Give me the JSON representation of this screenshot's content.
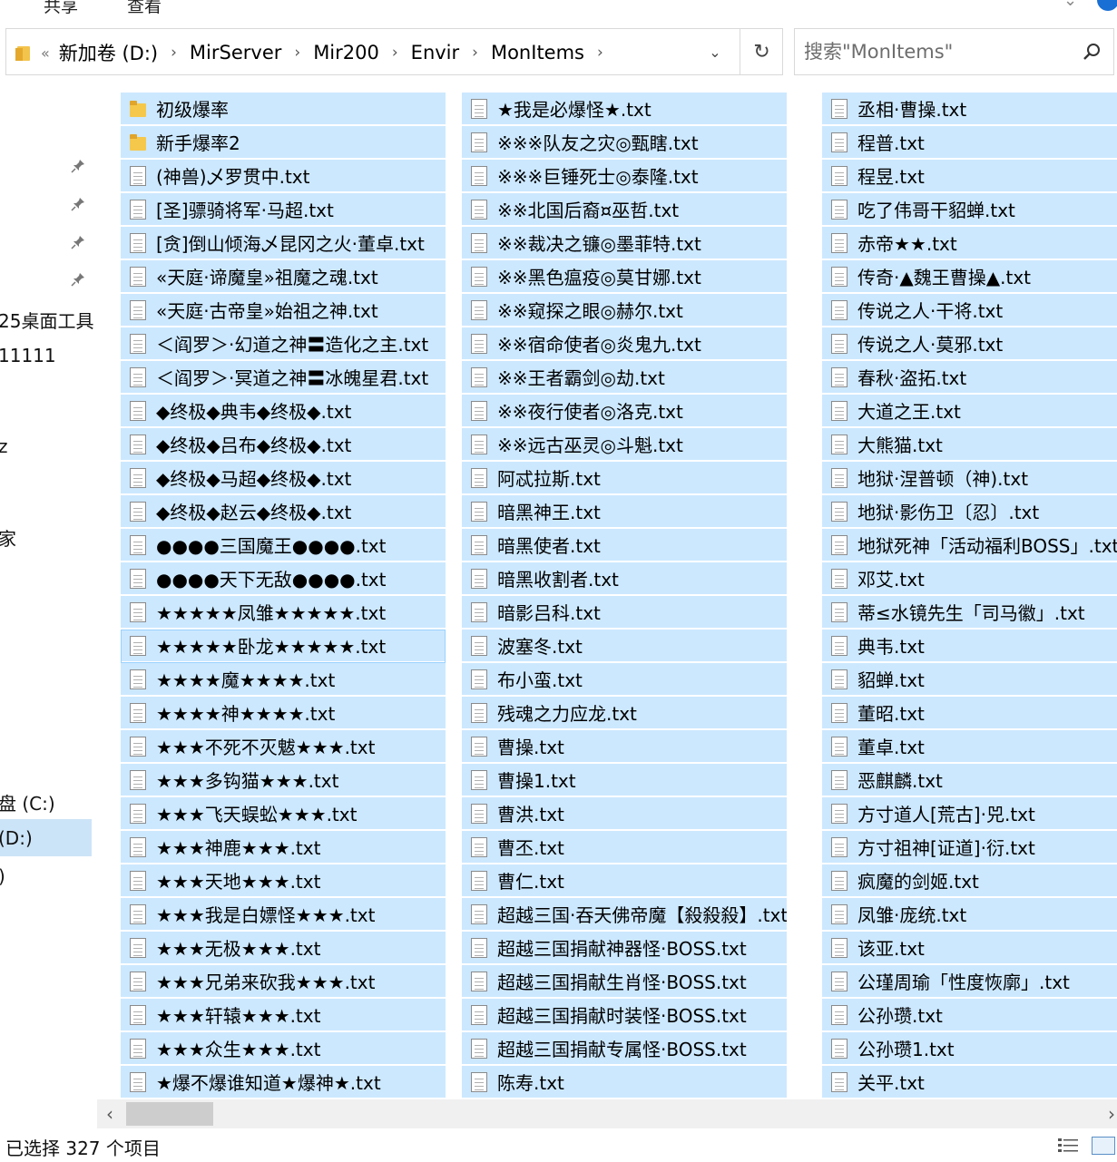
{
  "ribbon": {
    "tabs": [
      "共享",
      "查看"
    ]
  },
  "address": {
    "overflow": "«",
    "crumbs": [
      "新加卷 (D:)",
      "MirServer",
      "Mir200",
      "Envir",
      "MonItems"
    ]
  },
  "search": {
    "placeholder": "搜索\"MonItems\""
  },
  "nav": {
    "items": [
      "25桌面工具",
      "11111",
      "z",
      "家",
      "盘 (C:)",
      "(D:)",
      ")"
    ]
  },
  "files": {
    "col1": [
      {
        "name": "初级爆率",
        "type": "folder"
      },
      {
        "name": "新手爆率2",
        "type": "folder"
      },
      {
        "name": "(神兽)乄罗贯中.txt",
        "type": "file"
      },
      {
        "name": "[圣]骠骑将军·马超.txt",
        "type": "file"
      },
      {
        "name": "[贪]倒山倾海乄昆冈之火·董卓.txt",
        "type": "file"
      },
      {
        "name": "«天庭·谛魔皇»祖魔之魂.txt",
        "type": "file"
      },
      {
        "name": "«天庭·古帝皇»始祖之神.txt",
        "type": "file"
      },
      {
        "name": "＜阎罗＞·幻道之神〓造化之主.txt",
        "type": "file"
      },
      {
        "name": "＜阎罗＞·冥道之神〓冰魄星君.txt",
        "type": "file"
      },
      {
        "name": "◆终极◆典韦◆终极◆.txt",
        "type": "file"
      },
      {
        "name": "◆终极◆吕布◆终极◆.txt",
        "type": "file"
      },
      {
        "name": "◆终极◆马超◆终极◆.txt",
        "type": "file"
      },
      {
        "name": "◆终极◆赵云◆终极◆.txt",
        "type": "file"
      },
      {
        "name": "●●●●三国魔王●●●●.txt",
        "type": "file"
      },
      {
        "name": "●●●●天下无敌●●●●.txt",
        "type": "file"
      },
      {
        "name": "★★★★★凤雏★★★★★.txt",
        "type": "file"
      },
      {
        "name": "★★★★★卧龙★★★★★.txt",
        "type": "file"
      },
      {
        "name": "★★★★魔★★★★.txt",
        "type": "file"
      },
      {
        "name": "★★★★神★★★★.txt",
        "type": "file"
      },
      {
        "name": "★★★不死不灭魃★★★.txt",
        "type": "file"
      },
      {
        "name": "★★★多钩猫★★★.txt",
        "type": "file"
      },
      {
        "name": "★★★飞天蜈蚣★★★.txt",
        "type": "file"
      },
      {
        "name": "★★★神鹿★★★.txt",
        "type": "file"
      },
      {
        "name": "★★★天地★★★.txt",
        "type": "file"
      },
      {
        "name": "★★★我是白嫖怪★★★.txt",
        "type": "file"
      },
      {
        "name": "★★★无极★★★.txt",
        "type": "file"
      },
      {
        "name": "★★★兄弟来砍我★★★.txt",
        "type": "file"
      },
      {
        "name": "★★★轩辕★★★.txt",
        "type": "file"
      },
      {
        "name": "★★★众生★★★.txt",
        "type": "file"
      },
      {
        "name": "★爆不爆谁知道★爆神★.txt",
        "type": "file"
      }
    ],
    "col2": [
      {
        "name": "★我是必爆怪★.txt",
        "type": "file"
      },
      {
        "name": "※※※队友之灾◎甄瞎.txt",
        "type": "file"
      },
      {
        "name": "※※※巨锤死士◎泰隆.txt",
        "type": "file"
      },
      {
        "name": "※※北国后裔¤巫哲.txt",
        "type": "file"
      },
      {
        "name": "※※裁决之镰◎墨菲特.txt",
        "type": "file"
      },
      {
        "name": "※※黑色瘟疫◎莫甘娜.txt",
        "type": "file"
      },
      {
        "name": "※※窥探之眼◎赫尔.txt",
        "type": "file"
      },
      {
        "name": "※※宿命使者◎炎鬼九.txt",
        "type": "file"
      },
      {
        "name": "※※王者霸剑◎劫.txt",
        "type": "file"
      },
      {
        "name": "※※夜行使者◎洛克.txt",
        "type": "file"
      },
      {
        "name": "※※远古巫灵◎斗魁.txt",
        "type": "file"
      },
      {
        "name": "阿忒拉斯.txt",
        "type": "file"
      },
      {
        "name": "暗黑神王.txt",
        "type": "file"
      },
      {
        "name": "暗黑使者.txt",
        "type": "file"
      },
      {
        "name": "暗黑收割者.txt",
        "type": "file"
      },
      {
        "name": "暗影吕科.txt",
        "type": "file"
      },
      {
        "name": "波塞冬.txt",
        "type": "file"
      },
      {
        "name": "布小蛮.txt",
        "type": "file"
      },
      {
        "name": "残魂之力应龙.txt",
        "type": "file"
      },
      {
        "name": "曹操.txt",
        "type": "file"
      },
      {
        "name": "曹操1.txt",
        "type": "file"
      },
      {
        "name": "曹洪.txt",
        "type": "file"
      },
      {
        "name": "曹丕.txt",
        "type": "file"
      },
      {
        "name": "曹仁.txt",
        "type": "file"
      },
      {
        "name": "超越三国·吞天佛帝魔【殺殺殺】.txt",
        "type": "file"
      },
      {
        "name": "超越三国捐献神器怪·BOSS.txt",
        "type": "file"
      },
      {
        "name": "超越三国捐献生肖怪·BOSS.txt",
        "type": "file"
      },
      {
        "name": "超越三国捐献时装怪·BOSS.txt",
        "type": "file"
      },
      {
        "name": "超越三国捐献专属怪·BOSS.txt",
        "type": "file"
      },
      {
        "name": "陈寿.txt",
        "type": "file"
      }
    ],
    "col3": [
      {
        "name": "丞相·曹操.txt",
        "type": "file"
      },
      {
        "name": "程普.txt",
        "type": "file"
      },
      {
        "name": "程昱.txt",
        "type": "file"
      },
      {
        "name": "吃了伟哥干貂蝉.txt",
        "type": "file"
      },
      {
        "name": "赤帝★★.txt",
        "type": "file"
      },
      {
        "name": "传奇·▲魏王曹操▲.txt",
        "type": "file"
      },
      {
        "name": "传说之人·干将.txt",
        "type": "file"
      },
      {
        "name": "传说之人·莫邪.txt",
        "type": "file"
      },
      {
        "name": "春秋·盗拓.txt",
        "type": "file"
      },
      {
        "name": "大道之王.txt",
        "type": "file"
      },
      {
        "name": "大熊猫.txt",
        "type": "file"
      },
      {
        "name": "地狱·涅普顿（神).txt",
        "type": "file"
      },
      {
        "name": "地狱·影伤卫〔忍〕.txt",
        "type": "file"
      },
      {
        "name": "地狱死神「活动福利BOSS」.txt",
        "type": "file"
      },
      {
        "name": "邓艾.txt",
        "type": "file"
      },
      {
        "name": "蒂≤水镜先生「司马徽」.txt",
        "type": "file"
      },
      {
        "name": "典韦.txt",
        "type": "file"
      },
      {
        "name": "貂蝉.txt",
        "type": "file"
      },
      {
        "name": "董昭.txt",
        "type": "file"
      },
      {
        "name": "董卓.txt",
        "type": "file"
      },
      {
        "name": "恶麒麟.txt",
        "type": "file"
      },
      {
        "name": "方寸道人[荒古]·兕.txt",
        "type": "file"
      },
      {
        "name": "方寸祖神[证道]·衍.txt",
        "type": "file"
      },
      {
        "name": "疯魔的剑姬.txt",
        "type": "file"
      },
      {
        "name": "凤雏·庞统.txt",
        "type": "file"
      },
      {
        "name": "该亚.txt",
        "type": "file"
      },
      {
        "name": "公瑾周瑜「性度恢廓」.txt",
        "type": "file"
      },
      {
        "name": "公孙瓒.txt",
        "type": "file"
      },
      {
        "name": "公孙瓒1.txt",
        "type": "file"
      },
      {
        "name": "关平.txt",
        "type": "file"
      }
    ]
  },
  "status": {
    "text": "已选择 327 个项目"
  }
}
